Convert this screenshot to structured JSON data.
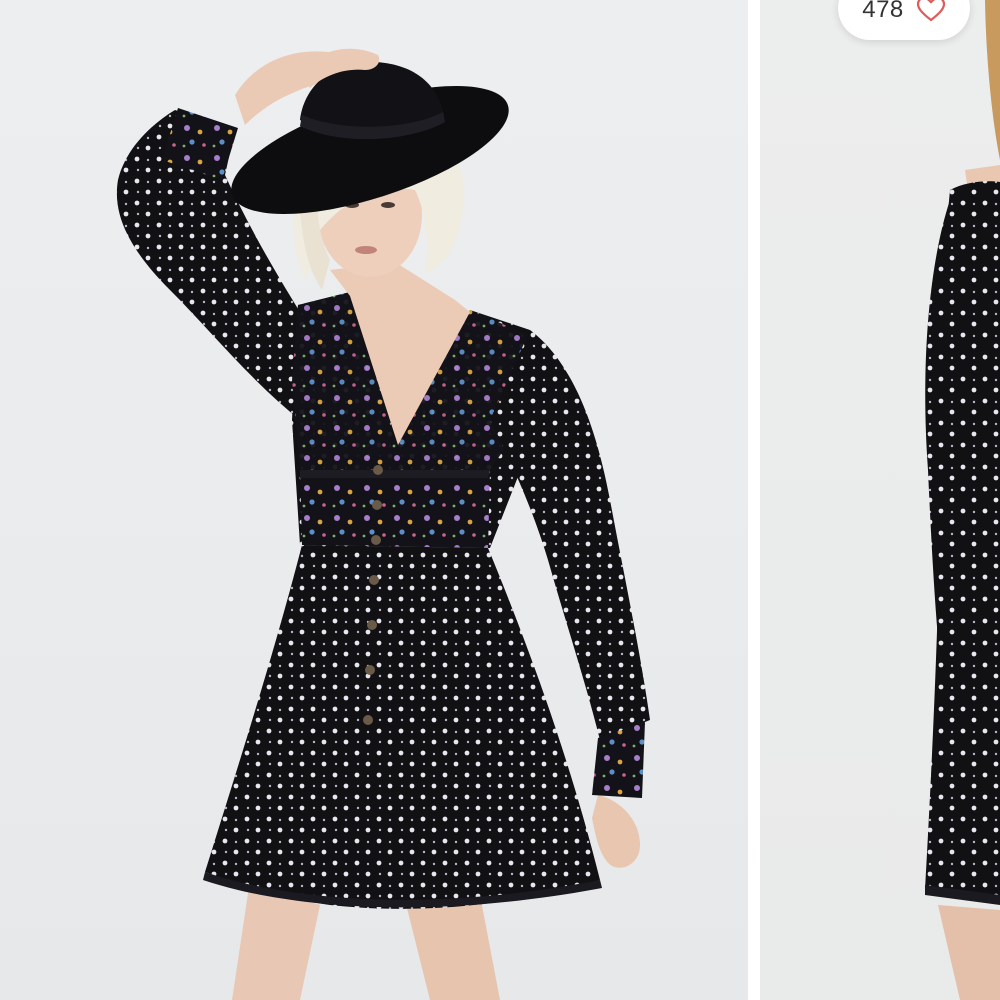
{
  "gallery": {
    "images": [
      {
        "alt": "",
        "icon": "product-photo-model-front"
      },
      {
        "alt": "",
        "icon": "product-photo-model-side"
      }
    ]
  },
  "like_button": {
    "count": "478",
    "icon": "heart-outline-icon",
    "color": "#e05a5a"
  },
  "colors": {
    "background": "#eceef0",
    "dress": "#0f0f12",
    "accent_heart": "#e05a5a"
  }
}
